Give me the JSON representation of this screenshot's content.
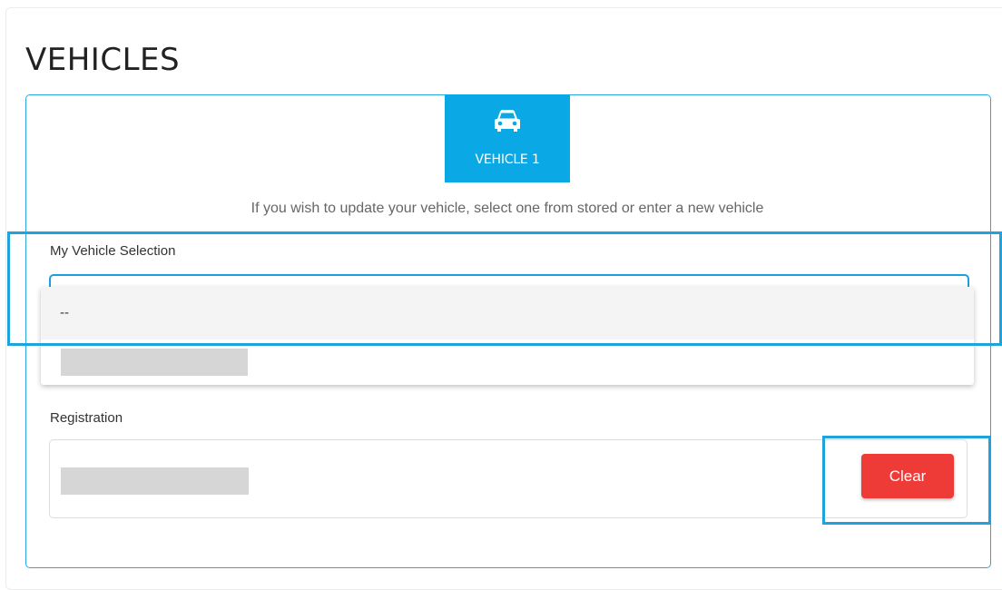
{
  "header": {
    "title": "VEHICLES"
  },
  "vehicle_tab": {
    "label": "VEHICLE 1",
    "icon": "car-icon"
  },
  "instruction": "If you wish to update your vehicle, select one from stored or enter a new vehicle",
  "vehicle_selection": {
    "label": "My Vehicle Selection",
    "options": [
      "--"
    ]
  },
  "registration": {
    "label": "Registration",
    "clear_label": "Clear"
  },
  "colors": {
    "accent": "#0aa9e6",
    "danger": "#ef3b37"
  }
}
